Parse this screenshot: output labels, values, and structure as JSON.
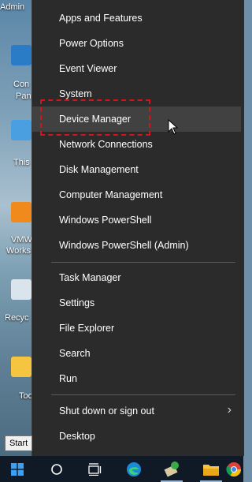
{
  "desktop": {
    "labels": [
      "Admin",
      "Con",
      "Pan",
      "This",
      "VMW",
      "Works",
      "Recyc",
      "Too"
    ]
  },
  "menu": {
    "group1": [
      "Apps and Features",
      "Power Options",
      "Event Viewer",
      "System",
      "Device Manager",
      "Network Connections",
      "Disk Management",
      "Computer Management",
      "Windows PowerShell",
      "Windows PowerShell (Admin)"
    ],
    "group2": [
      "Task Manager",
      "Settings",
      "File Explorer",
      "Search",
      "Run"
    ],
    "group3": [
      "Shut down or sign out",
      "Desktop"
    ],
    "highlighted": "Device Manager"
  },
  "tooltip": "Start",
  "taskbar": {
    "icons": [
      "windows-start-icon",
      "search-circle-icon",
      "task-view-icon",
      "edge-icon",
      "pinned-app-icon",
      "file-explorer-icon",
      "chrome-icon"
    ]
  },
  "colors": {
    "menu_bg": "#2b2b2b",
    "hover_bg": "#414141",
    "highlight_border": "#d4141c",
    "taskbar_bg": "#101a26"
  }
}
